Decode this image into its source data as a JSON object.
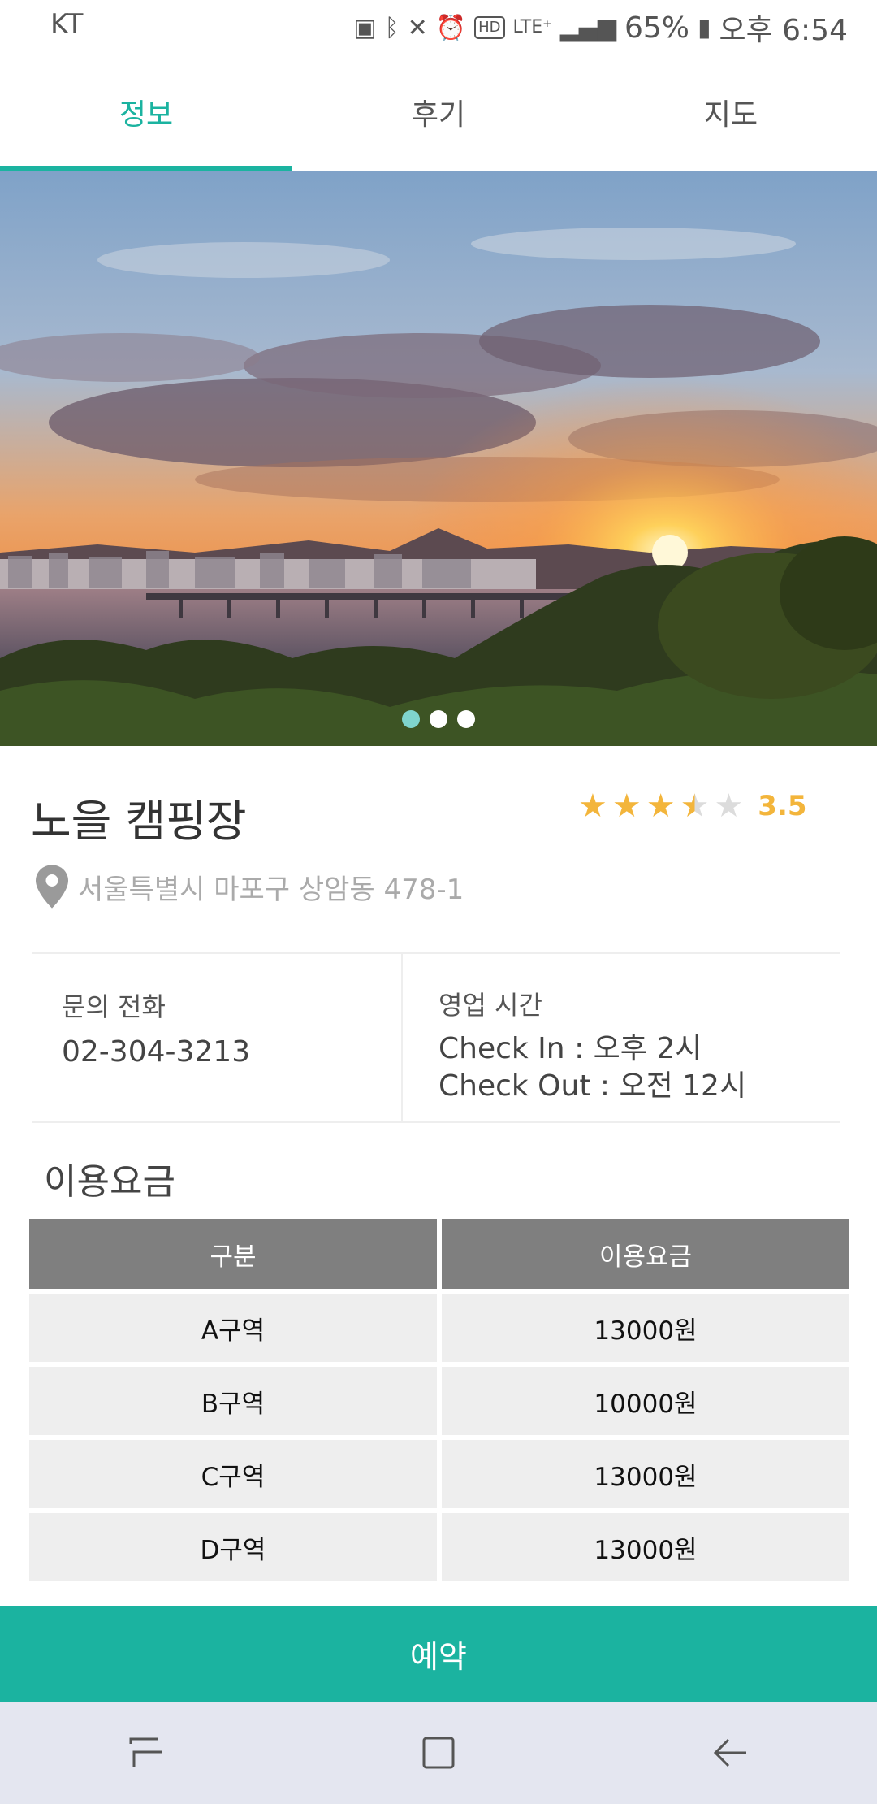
{
  "status_bar": {
    "carrier": "KT",
    "battery": "65%",
    "time": "오후 6:54"
  },
  "tabs": [
    {
      "label": "정보",
      "active": true
    },
    {
      "label": "후기",
      "active": false
    },
    {
      "label": "지도",
      "active": false
    }
  ],
  "hero": {
    "image_alt": "sunset over river and bridge",
    "page_count": 3,
    "active_page": 1
  },
  "place": {
    "name": "노을 캠핑장",
    "rating": 3.5,
    "rating_text": "3.5",
    "address": "서울특별시 마포구 상암동 478-1"
  },
  "info": {
    "phone_label": "문의 전화",
    "phone": "02-304-3213",
    "hours_label": "영업 시간",
    "check_in": "Check In : 오후 2시",
    "check_out": "Check Out : 오전 12시"
  },
  "pricing": {
    "title": "이용요금",
    "headers": [
      "구분",
      "이용요금"
    ],
    "rows": [
      [
        "A구역",
        "13000원"
      ],
      [
        "B구역",
        "10000원"
      ],
      [
        "C구역",
        "13000원"
      ],
      [
        "D구역",
        "13000원"
      ]
    ]
  },
  "reserve_label": "예약",
  "colors": {
    "accent": "#1bb3a0",
    "star": "#f3b53b",
    "table_header": "#7f7f7f",
    "table_cell": "#eeeeee",
    "navbar": "#e4e6f0"
  }
}
